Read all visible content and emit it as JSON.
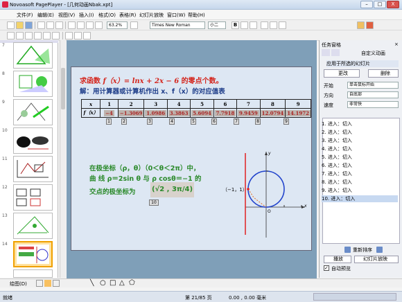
{
  "window": {
    "title": "Novoasoft PagePlayer - [几何动画Nbak.xpt]",
    "min": "–",
    "max": "□",
    "close": "X"
  },
  "menu": [
    "文件(F)",
    "编辑(E)",
    "视图(V)",
    "插入(I)",
    "格式(O)",
    "表格(R)",
    "幻灯片放映",
    "窗口(W)",
    "帮助(H)"
  ],
  "toolbar": {
    "zoom": "63.2%",
    "font": "Times New Roman",
    "size": "小二"
  },
  "thumbs": [
    {
      "n": "7"
    },
    {
      "n": "8"
    },
    {
      "n": "9"
    },
    {
      "n": "10"
    },
    {
      "n": "11"
    },
    {
      "n": "12"
    },
    {
      "n": "13"
    },
    {
      "n": "14"
    }
  ],
  "slide": {
    "line1_pre": "求函数 ",
    "line1_math": "f（x）= lnx + 2x − 6",
    "line1_post": " 的零点个数。",
    "line2": "解：用计算器或计算机作出 x、f（x）的对应值表",
    "table": {
      "header": [
        "x",
        "1",
        "2",
        "3",
        "4",
        "5",
        "6",
        "7",
        "8",
        "9"
      ],
      "row_label": "f（x）",
      "values": [
        "−4",
        "−1.3069",
        "1.0986",
        "3.3863",
        "5.6094",
        "7.7918",
        "9.9459",
        "12.0794",
        "14.1972"
      ],
      "labels": [
        "1",
        "2",
        "3",
        "4",
        "5",
        "6",
        "7",
        "8",
        "9"
      ]
    },
    "polar1": "在极坐标（ρ，θ）（0＜θ＜2π）中，",
    "polar2": "曲 线 ρ＝2sin θ 与 ρ  cosθ＝−1  的",
    "polar3": "交点的极坐标为",
    "answer": "(√2 , 3π/4)",
    "answer_label": "10",
    "point_label": "（−1，1）",
    "axis_x": "x",
    "axis_y": "y",
    "origin": "O"
  },
  "taskpane": {
    "title": "任务窗格",
    "header": "自定义动画",
    "applies": "应用于所选的幻灯片",
    "change": "更改",
    "delete": "删除",
    "start_label": "开始",
    "start_val": "单击鼠标开始",
    "dir_label": "方向",
    "dir_val": "自底部",
    "speed_label": "速度",
    "speed_val": "非常快",
    "anims": [
      "1. 进入：切入",
      "2. 进入：切入",
      "3. 进入：切入",
      "4. 进入：切入",
      "5. 进入：切入",
      "6. 进入：切入",
      "7. 进入：切入",
      "8. 进入：切入",
      "9. 进入：切入",
      "10. 进入：切入"
    ],
    "reorder": "重新排序",
    "play": "播放",
    "slideshow": "幻灯片放映",
    "autopreview": "自动预览"
  },
  "drawbar": {
    "draw": "绘图(D)"
  },
  "status": {
    "left": "就绪",
    "page": "第 21/85 页",
    "pos": "0.00 , 0.00 毫米"
  }
}
